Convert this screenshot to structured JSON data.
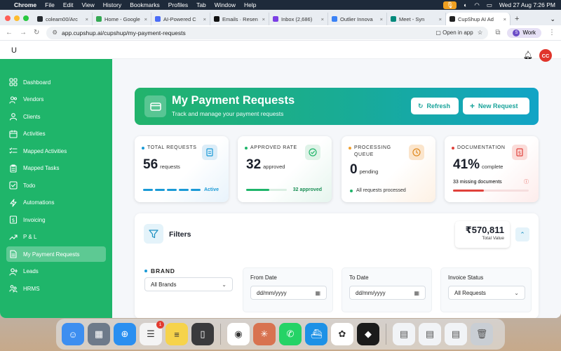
{
  "os": {
    "menu_app": "Chrome",
    "menu_items": [
      "File",
      "Edit",
      "View",
      "History",
      "Bookmarks",
      "Profiles",
      "Tab",
      "Window",
      "Help"
    ],
    "clock": "Wed 27 Aug  7:26 PM"
  },
  "browser": {
    "tabs": [
      {
        "title": "coleam00/Arc",
        "color": "#24292f"
      },
      {
        "title": "Home - Google",
        "color": "#34a853"
      },
      {
        "title": "AI-Powered C",
        "color": "#4a6cf7"
      },
      {
        "title": "Emails · Resen",
        "color": "#111111"
      },
      {
        "title": "Inbox (2,686)",
        "color": "#7b3fe4"
      },
      {
        "title": "Outlier Innova",
        "color": "#3b82f6"
      },
      {
        "title": "Meet - Syn",
        "color": "#00897b"
      },
      {
        "title": "CupShup AI Ad",
        "color": "#222222"
      }
    ],
    "active_tab": 7,
    "url": "app.cupshup.ai/cupshup/my-payment-requests",
    "open_in_app": "Open in app",
    "profile_initial": "S",
    "profile_label": "Work"
  },
  "app": {
    "logo": "U",
    "avatar": "CC",
    "sidebar": [
      {
        "label": "Dashboard",
        "icon": "dashboard-icon"
      },
      {
        "label": "Vendors",
        "icon": "users-icon"
      },
      {
        "label": "Clients",
        "icon": "user-icon"
      },
      {
        "label": "Activities",
        "icon": "calendar-icon"
      },
      {
        "label": "Mapped Activities",
        "icon": "list-check-icon"
      },
      {
        "label": "Mapped Tasks",
        "icon": "clipboard-icon"
      },
      {
        "label": "Todo",
        "icon": "checkbox-icon"
      },
      {
        "label": "Automations",
        "icon": "bolt-icon"
      },
      {
        "label": "Invoicing",
        "icon": "dollar-icon"
      },
      {
        "label": "P & L",
        "icon": "trend-icon"
      },
      {
        "label": "My Payment Requests",
        "icon": "file-icon"
      },
      {
        "label": "Leads",
        "icon": "user-plus-icon"
      },
      {
        "label": "HRMS",
        "icon": "team-icon"
      }
    ],
    "active_nav": 10,
    "hero": {
      "title": "My Payment Requests",
      "subtitle": "Track and manage your payment requests",
      "refresh": "Refresh",
      "new_request": "New Request"
    },
    "cards": {
      "total": {
        "label": "TOTAL REQUESTS",
        "value": "56",
        "unit": "requests",
        "status": "Active",
        "accent": "#1a9ad6"
      },
      "approved": {
        "label": "APPROVED RATE",
        "value": "32",
        "unit": "approved",
        "footer": "32 approved",
        "progress": 0.57,
        "accent": "#1fb56a"
      },
      "processing": {
        "label": "PROCESSING QUEUE",
        "value": "0",
        "unit": "pending",
        "footer": "All requests processed",
        "accent": "#f0a030"
      },
      "documentation": {
        "label": "DOCUMENTATION",
        "value": "41%",
        "unit": "complete",
        "footer": "33 missing documents",
        "progress": 0.41,
        "accent": "#e0413b"
      }
    },
    "filters": {
      "title": "Filters",
      "total_value": "₹570,811",
      "total_label": "Total Value",
      "brand_label": "BRAND",
      "brand_value": "All Brands",
      "from_label": "From Date",
      "from_placeholder": "dd/mm/yyyy",
      "to_label": "To Date",
      "to_placeholder": "dd/mm/yyyy",
      "status_label": "Invoice Status",
      "status_value": "All Requests"
    }
  },
  "dock": {
    "apps": [
      {
        "name": "finder-icon",
        "color": "#3d8ef0"
      },
      {
        "name": "launchpad-icon",
        "color": "#6e7a8a"
      },
      {
        "name": "safari-icon",
        "color": "#2a8ff0"
      },
      {
        "name": "reminders-icon",
        "color": "#f4f4f4",
        "badge": "1"
      },
      {
        "name": "notes-icon",
        "color": "#f6d34b"
      },
      {
        "name": "iphone-mirroring-icon",
        "color": "#3a3a3c"
      },
      {
        "name": "chrome-icon",
        "color": "#ffffff"
      },
      {
        "name": "claude-icon",
        "color": "#d87350"
      },
      {
        "name": "whatsapp-icon",
        "color": "#25d366"
      },
      {
        "name": "docker-icon",
        "color": "#1d91e6"
      },
      {
        "name": "chatgpt-icon",
        "color": "#ffffff"
      },
      {
        "name": "cursor-icon",
        "color": "#1b1b1b"
      }
    ]
  }
}
